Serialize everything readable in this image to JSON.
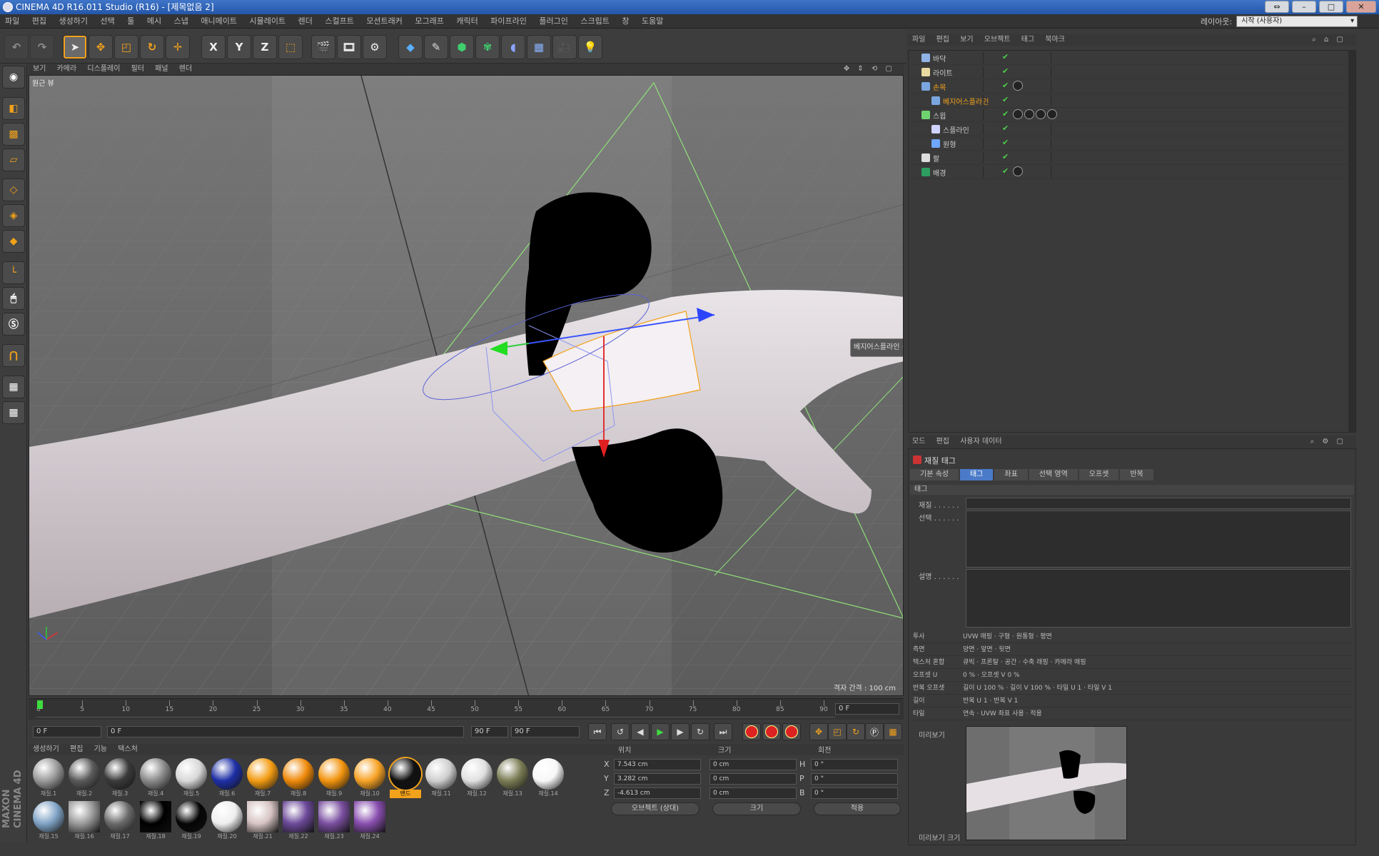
{
  "window": {
    "title": "CINEMA 4D R16.011 Studio (R16) - [제목없음 2]",
    "buttons": [
      "⇔",
      "–",
      "□",
      "✕"
    ]
  },
  "menubar": {
    "items": [
      "파일",
      "편집",
      "생성하기",
      "선택",
      "툴",
      "메시",
      "스냅",
      "애니메이트",
      "시뮬레이트",
      "렌더",
      "스컬프트",
      "모션트래커",
      "모그래프",
      "캐릭터",
      "파이프라인",
      "플러그인",
      "스크립트",
      "창",
      "도움말"
    ],
    "layout_label": "레이아웃:",
    "layout_value": "시작 (사용자)"
  },
  "toolbar": {
    "axis_x": "X",
    "axis_y": "Y",
    "axis_z": "Z"
  },
  "viewport": {
    "menu": [
      "보기",
      "카메라",
      "디스플레이",
      "필터",
      "패널",
      "렌더"
    ],
    "label": "원근 뷰",
    "footer": "격자 간격 : 100 cm",
    "hud_text": "베지어스플라인 · 대체"
  },
  "timeline": {
    "ticks": [
      "0",
      "5",
      "10",
      "15",
      "20",
      "25",
      "30",
      "35",
      "40",
      "45",
      "50",
      "55",
      "60",
      "65",
      "70",
      "75",
      "80",
      "85",
      "90"
    ],
    "frame_end": "0 F"
  },
  "transport": {
    "start_frame": "0 F",
    "current_frame": "0 F",
    "range_end": "90 F",
    "end_frame": "90 F"
  },
  "materials": {
    "menu": [
      "생성하기",
      "편집",
      "기능",
      "텍스처"
    ],
    "items": [
      {
        "label": "재질.1",
        "color": "#9a9a9a"
      },
      {
        "label": "재질.2",
        "color": "#5a5a5a"
      },
      {
        "label": "재질.3",
        "color": "#3a3a3a"
      },
      {
        "label": "재질.4",
        "color": "#8a8a8a"
      },
      {
        "label": "재질.5",
        "color": "#d8d8d8"
      },
      {
        "label": "재질.6",
        "color": "#1e2fa6"
      },
      {
        "label": "재질.7",
        "color": "#f39c12"
      },
      {
        "label": "재질.8",
        "color": "#ef8a0a"
      },
      {
        "label": "재질.9",
        "color": "#f2940e"
      },
      {
        "label": "재질.10",
        "color": "#f7a325"
      },
      {
        "label": "밴드",
        "color": "#111111"
      },
      {
        "label": "재질.11",
        "color": "#cfcfcf"
      },
      {
        "label": "재질.12",
        "color": "#e0e0e0"
      },
      {
        "label": "재질.13",
        "color": "#7b7d55"
      },
      {
        "label": "재질.14",
        "color": "#f7f7f7"
      },
      {
        "label": "재질.15",
        "color": "#7fa3c5"
      },
      {
        "label": "재질.16",
        "color": "#9a9a9a"
      },
      {
        "label": "재질.17",
        "color": "#6a6a6a"
      },
      {
        "label": "재질.18",
        "color": "#000000"
      },
      {
        "label": "재질.19",
        "color": "#050505"
      },
      {
        "label": "재질.20",
        "color": "#eeeeee"
      },
      {
        "label": "재질.21",
        "color": "#d7c3c3"
      },
      {
        "label": "재질.22",
        "color": "#6d4a9a"
      },
      {
        "label": "재질.23",
        "color": "#7a4fa0"
      },
      {
        "label": "재질.24",
        "color": "#8a4fb0"
      }
    ],
    "selected_label": "밴드"
  },
  "coords": {
    "headers": [
      "위치",
      "크기",
      "회전"
    ],
    "rows": [
      {
        "axis": "X",
        "pos": "7.543 cm",
        "size": "0 cm",
        "rot_axis": "H",
        "rot": "0 °"
      },
      {
        "axis": "Y",
        "pos": "3.282 cm",
        "size": "0 cm",
        "rot_axis": "P",
        "rot": "0 °"
      },
      {
        "axis": "Z",
        "pos": "-4.613 cm",
        "size": "0 cm",
        "rot_axis": "B",
        "rot": "0 °"
      }
    ],
    "mode_select": "오브젝트 (상대)",
    "size_select": "크기",
    "apply_button": "적용"
  },
  "objects": {
    "menu": [
      "파일",
      "편집",
      "보기",
      "오브젝트",
      "태그",
      "북마크"
    ],
    "items": [
      {
        "name": "바닥",
        "indent": 0,
        "color": "#8fb3e6",
        "selected": false
      },
      {
        "name": "라이트",
        "indent": 0,
        "color": "#e8d9a0",
        "selected": false
      },
      {
        "name": "손목",
        "indent": 0,
        "color": "#7aa6e0",
        "selected": true
      },
      {
        "name": "베지어스플라인",
        "indent": 1,
        "color": "#7aa6e0",
        "selected": true
      },
      {
        "name": "스윕",
        "indent": 0,
        "color": "#6fd36f",
        "selected": false
      },
      {
        "name": "스플라인",
        "indent": 1,
        "color": "#cfd3ff",
        "selected": false
      },
      {
        "name": "원형",
        "indent": 1,
        "color": "#6fa6ff",
        "selected": false
      },
      {
        "name": "팔",
        "indent": 0,
        "color": "#dddddd",
        "selected": false
      },
      {
        "name": "배경",
        "indent": 0,
        "color": "#2e9e60",
        "selected": false
      }
    ]
  },
  "attributes": {
    "menu": [
      "모드",
      "편집",
      "사용자 데이터"
    ],
    "title": "재질 태그",
    "tabs": [
      {
        "label": "기본 속성",
        "active": false
      },
      {
        "label": "태그",
        "active": true
      },
      {
        "label": "좌표",
        "active": false
      },
      {
        "label": "선택 영역",
        "active": false
      },
      {
        "label": "오프셋",
        "active": false
      },
      {
        "label": "반복",
        "active": false
      }
    ],
    "section": "태그",
    "fields": {
      "material_label": "재질 . . . . . .",
      "selection_label": "선택 . . . . . .",
      "offset_label": "설명 . . . . . .",
      "projection_label": "투사",
      "side_label": "측면",
      "mix_label": "텍스처 혼합",
      "tile_label": "타일",
      "repeat_label": "반복 오프셋",
      "length_label": "길이",
      "preview_label": "미리보기",
      "bottom_label": "미리보기 크기"
    },
    "lines": [
      {
        "k": "투사",
        "v": "UVW 매핑  ·  구형  ·  원통형  ·  평면"
      },
      {
        "k": "측면",
        "v": "양면  ·  앞면  ·  뒷면"
      },
      {
        "k": "텍스처 혼합",
        "v": "큐빅 · 프론탈 · 공간 · 수축 래핑 · 카메라 매핑"
      },
      {
        "k": "오프셋 U",
        "v": "0 %   ·   오프셋 V  0 %"
      },
      {
        "k": "반복 오프셋",
        "v": "길이 U 100 % · 길이 V 100 % · 타일 U 1 · 타일 V 1"
      },
      {
        "k": "길이",
        "v": "반복 U 1  ·  반복 V 1"
      },
      {
        "k": "타일",
        "v": "연속  ·  UVW 좌표 사용  ·  적용"
      }
    ]
  }
}
